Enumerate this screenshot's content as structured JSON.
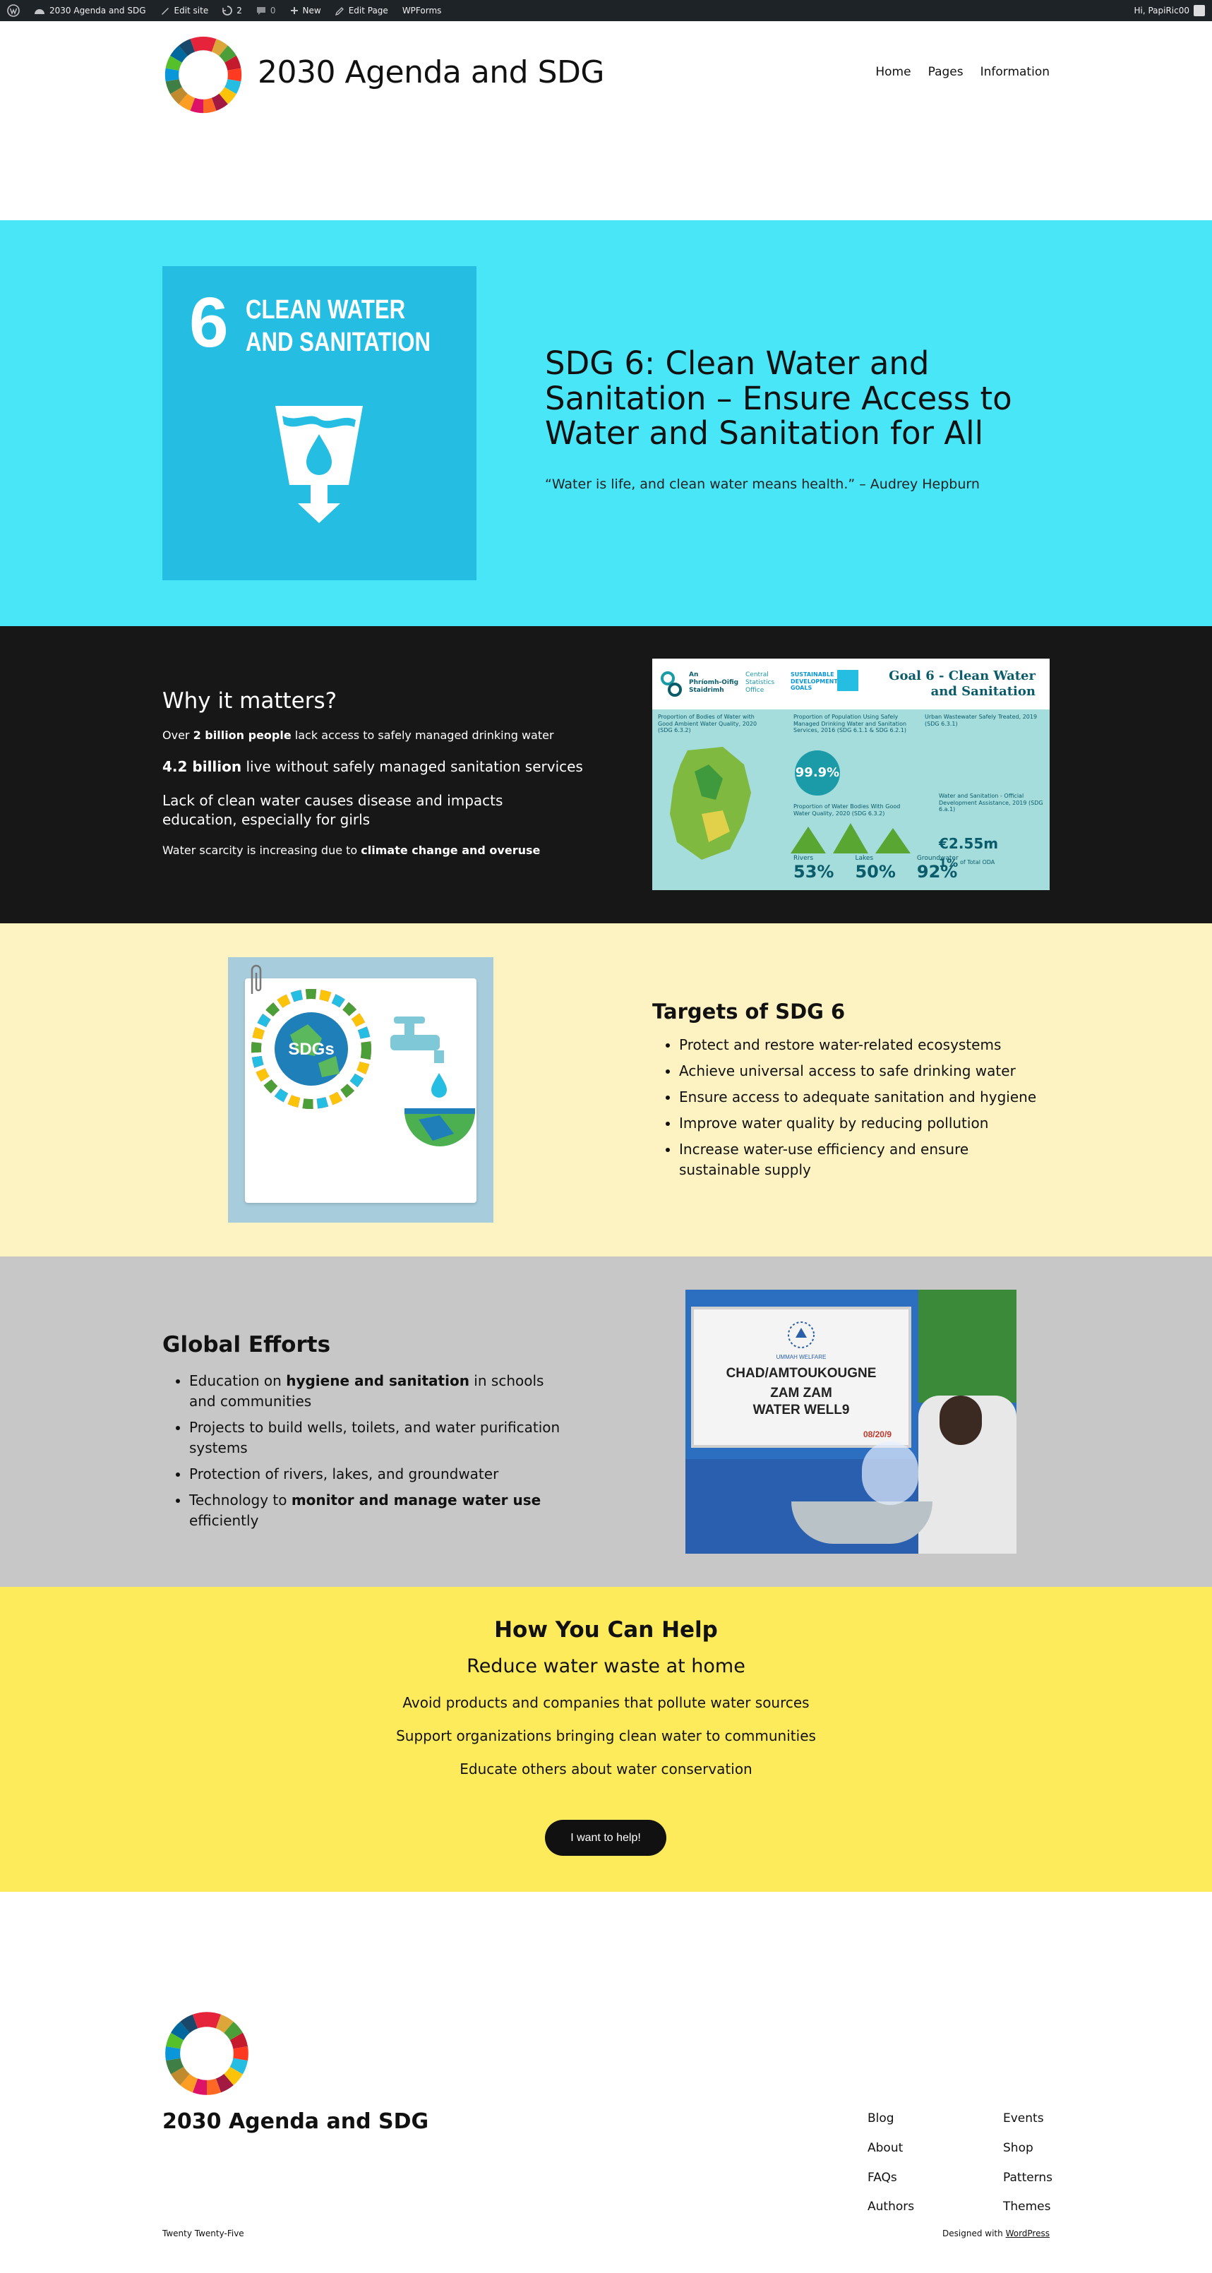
{
  "admin_bar": {
    "site": "2030 Agenda and SDG",
    "edit_site": "Edit site",
    "updates": "2",
    "comments": "0",
    "new": "New",
    "edit_page": "Edit Page",
    "plugin": "WPForms",
    "greeting": "Hi, PapiRic00"
  },
  "header": {
    "title": "2030 Agenda and SDG",
    "nav": [
      "Home",
      "Pages",
      "Information"
    ]
  },
  "hero": {
    "tile_number": "6",
    "tile_name_line1": "CLEAN WATER",
    "tile_name_line2": "AND SANITATION",
    "title": "SDG 6: Clean Water and Sanitation – Ensure Access to Water and Sanitation for All",
    "quote": "“Water is life, and clean water means health.” – Audrey Hepburn",
    "colors": {
      "background": "#48e6f7",
      "tile": "#26bde2"
    }
  },
  "why": {
    "heading": "Why it matters?",
    "p1_a": "Over ",
    "p1_b": "2 billion people",
    "p1_c": " lack access to safely managed drinking water",
    "p2_a": "4.2 billion",
    "p2_b": " live without safely managed sanitation services",
    "p3": "Lack of clean water causes disease and impacts education, especially for girls",
    "p4_a": "Water scarcity is increasing due to ",
    "p4_b": "climate change and overuse",
    "infographic": {
      "org_line1": "An",
      "org_line2": "Phríomh-Oifig",
      "org_line3": "Staidrimh",
      "cso_line1": "Central",
      "cso_line2": "Statistics",
      "cso_line3": "Office",
      "goals_label": "SUSTAINABLE DEVELOPMENT GOALS",
      "title_line1": "Goal 6 - Clean Water",
      "title_line2": "and Sanitation",
      "col1": "Proportion of Bodies of Water with Good Ambient Water Quality, 2020 (SDG 6.3.2)",
      "col2": "Proportion of Population Using Safely Managed Drinking Water and Sanitation Services, 2016 (SDG 6.1.1 & SDG 6.2.1)",
      "col3": "Urban Wastewater Safely Treated, 2019 (SDG 6.3.1)",
      "big_pct": "99.9%",
      "col2b": "Proportion of Water Bodies With Good Water Quality, 2020 (SDG 6.3.2)",
      "col3b": "Water and Sanitation - Official Development Assistance, 2019 (SDG 6.a.1)",
      "oda": "€2.55m",
      "oda_share": "1%",
      "oda_share_label": "of Total ODA",
      "stats": [
        {
          "label": "Rivers",
          "value": "53%"
        },
        {
          "label": "Lakes",
          "value": "50%"
        },
        {
          "label": "Groundwater",
          "value": "92%"
        }
      ]
    }
  },
  "targets": {
    "heading": "Targets of SDG 6",
    "badge": "SDGs",
    "items": [
      "Protect and restore water-related ecosystems",
      "Achieve universal access to safe drinking water",
      "Ensure access to adequate sanitation and hygiene",
      "Improve water quality by reducing pollution",
      "Increase water-use efficiency and ensure sustainable supply"
    ]
  },
  "global": {
    "heading": "Global Efforts",
    "i1_a": "Education on ",
    "i1_b": "hygiene and sanitation",
    "i1_c": " in schools and communities",
    "i2": "Projects to build wells, toilets, and water purification systems",
    "i3": "Protection of rivers, lakes, and groundwater",
    "i4_a": "Technology to ",
    "i4_b": "monitor and manage water use",
    "i4_c": " efficiently",
    "sign_line1": "CHAD/AMTOUKOUGNE",
    "sign_line2": "ZAM ZAM",
    "sign_line3": "WATER WELL9",
    "sign_date": "08/20/9",
    "sign_logo": "UMMAH WELFARE"
  },
  "help": {
    "heading": "How You Can Help",
    "sub": "Reduce water waste at home",
    "l1": "Avoid products and companies that pollute water sources",
    "l2": "Support organizations bringing clean water to communities",
    "l3": "Educate others about water conservation",
    "button": "I want to help!"
  },
  "footer": {
    "title": "2030 Agenda and SDG",
    "col1": [
      "Blog",
      "About",
      "FAQs",
      "Authors"
    ],
    "col2": [
      "Events",
      "Shop",
      "Patterns",
      "Themes"
    ],
    "theme": "Twenty Twenty-Five",
    "designed_prefix": "Designed with ",
    "designed_link": "WordPress"
  }
}
